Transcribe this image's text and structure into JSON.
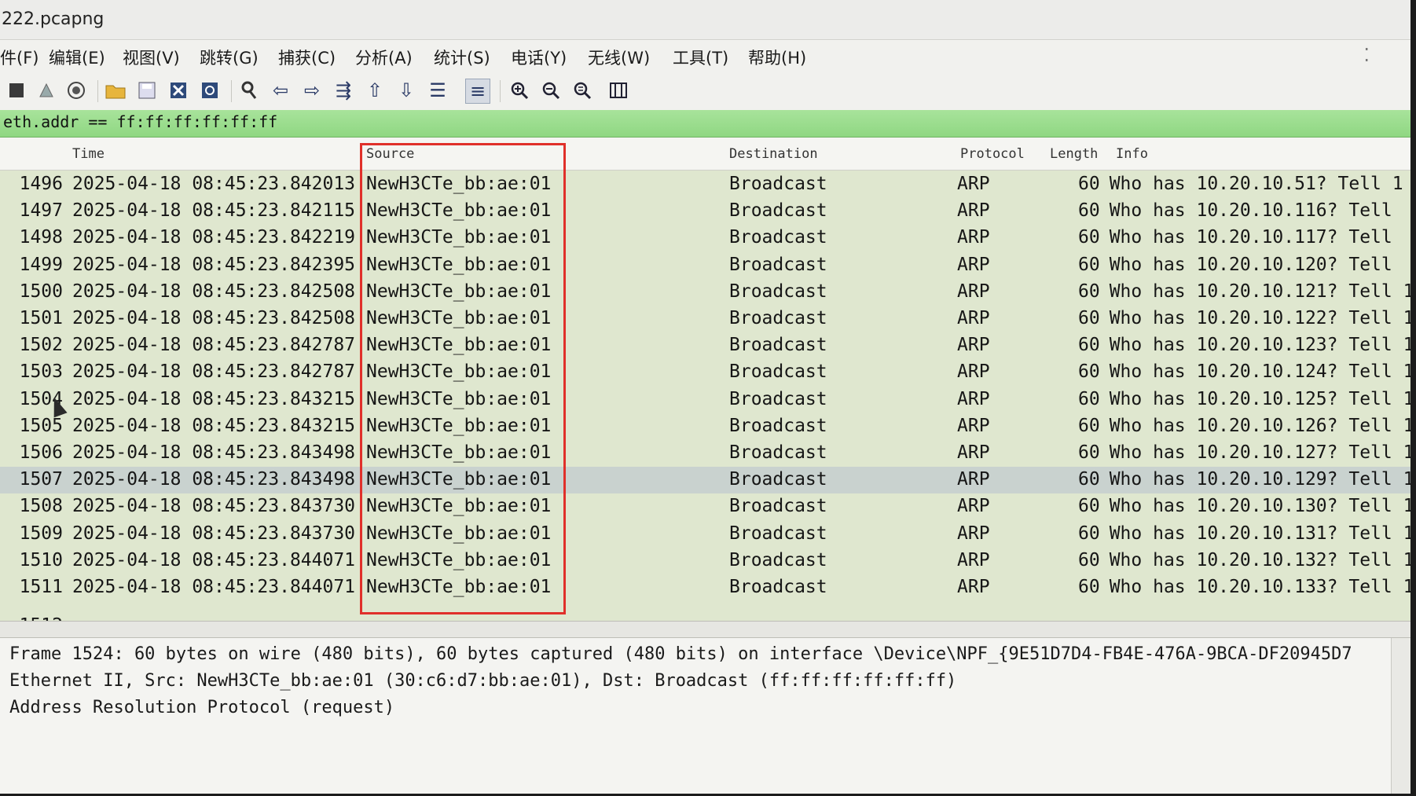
{
  "window": {
    "title": "222.pcapng"
  },
  "menu": [
    "件(F)",
    "编辑(E)",
    "视图(V)",
    "跳转(G)",
    "捕获(C)",
    "分析(A)",
    "统计(S)",
    "电话(Y)",
    "无线(W)",
    "工具(T)",
    "帮助(H)"
  ],
  "toolbar": {
    "icons": [
      "stop-capture-icon",
      "restart-capture-icon",
      "capture-options-icon",
      "open-file-icon",
      "save-file-icon",
      "close-file-icon",
      "reload-file-icon",
      "find-packet-icon",
      "go-back-icon",
      "go-forward-icon",
      "go-to-packet-icon",
      "go-first-icon",
      "go-last-icon",
      "autoscroll-icon",
      "colorize-icon",
      "zoom-in-icon",
      "zoom-out-icon",
      "zoom-normal-icon",
      "resize-columns-icon"
    ]
  },
  "filter": {
    "value": "eth.addr == ff:ff:ff:ff:ff:ff"
  },
  "columns": {
    "time": "Time",
    "source": "Source",
    "destination": "Destination",
    "protocol": "Protocol",
    "length": "Length",
    "info": "Info"
  },
  "packets": [
    {
      "no": "1496",
      "time": "2025-04-18 08:45:23.842013",
      "source": "NewH3CTe_bb:ae:01",
      "destination": "Broadcast",
      "protocol": "ARP",
      "length": "60",
      "info": "Who has 10.20.10.51? Tell 1"
    },
    {
      "no": "1497",
      "time": "2025-04-18 08:45:23.842115",
      "source": "NewH3CTe_bb:ae:01",
      "destination": "Broadcast",
      "protocol": "ARP",
      "length": "60",
      "info": "Who has 10.20.10.116? Tell"
    },
    {
      "no": "1498",
      "time": "2025-04-18 08:45:23.842219",
      "source": "NewH3CTe_bb:ae:01",
      "destination": "Broadcast",
      "protocol": "ARP",
      "length": "60",
      "info": "Who has 10.20.10.117? Tell"
    },
    {
      "no": "1499",
      "time": "2025-04-18 08:45:23.842395",
      "source": "NewH3CTe_bb:ae:01",
      "destination": "Broadcast",
      "protocol": "ARP",
      "length": "60",
      "info": "Who has 10.20.10.120? Tell"
    },
    {
      "no": "1500",
      "time": "2025-04-18 08:45:23.842508",
      "source": "NewH3CTe_bb:ae:01",
      "destination": "Broadcast",
      "protocol": "ARP",
      "length": "60",
      "info": "Who has 10.20.10.121? Tell 1"
    },
    {
      "no": "1501",
      "time": "2025-04-18 08:45:23.842508",
      "source": "NewH3CTe_bb:ae:01",
      "destination": "Broadcast",
      "protocol": "ARP",
      "length": "60",
      "info": "Who has 10.20.10.122? Tell 1"
    },
    {
      "no": "1502",
      "time": "2025-04-18 08:45:23.842787",
      "source": "NewH3CTe_bb:ae:01",
      "destination": "Broadcast",
      "protocol": "ARP",
      "length": "60",
      "info": "Who has 10.20.10.123? Tell 1"
    },
    {
      "no": "1503",
      "time": "2025-04-18 08:45:23.842787",
      "source": "NewH3CTe_bb:ae:01",
      "destination": "Broadcast",
      "protocol": "ARP",
      "length": "60",
      "info": "Who has 10.20.10.124? Tell 1"
    },
    {
      "no": "1504",
      "time": "2025-04-18 08:45:23.843215",
      "source": "NewH3CTe_bb:ae:01",
      "destination": "Broadcast",
      "protocol": "ARP",
      "length": "60",
      "info": "Who has 10.20.10.125? Tell 1"
    },
    {
      "no": "1505",
      "time": "2025-04-18 08:45:23.843215",
      "source": "NewH3CTe_bb:ae:01",
      "destination": "Broadcast",
      "protocol": "ARP",
      "length": "60",
      "info": "Who has 10.20.10.126? Tell 1"
    },
    {
      "no": "1506",
      "time": "2025-04-18 08:45:23.843498",
      "source": "NewH3CTe_bb:ae:01",
      "destination": "Broadcast",
      "protocol": "ARP",
      "length": "60",
      "info": "Who has 10.20.10.127? Tell 1"
    },
    {
      "no": "1507",
      "time": "2025-04-18 08:45:23.843498",
      "source": "NewH3CTe_bb:ae:01",
      "destination": "Broadcast",
      "protocol": "ARP",
      "length": "60",
      "info": "Who has 10.20.10.129? Tell 1",
      "selected": true
    },
    {
      "no": "1508",
      "time": "2025-04-18 08:45:23.843730",
      "source": "NewH3CTe_bb:ae:01",
      "destination": "Broadcast",
      "protocol": "ARP",
      "length": "60",
      "info": "Who has 10.20.10.130? Tell 1"
    },
    {
      "no": "1509",
      "time": "2025-04-18 08:45:23.843730",
      "source": "NewH3CTe_bb:ae:01",
      "destination": "Broadcast",
      "protocol": "ARP",
      "length": "60",
      "info": "Who has 10.20.10.131? Tell 1"
    },
    {
      "no": "1510",
      "time": "2025-04-18 08:45:23.844071",
      "source": "NewH3CTe_bb:ae:01",
      "destination": "Broadcast",
      "protocol": "ARP",
      "length": "60",
      "info": "Who has 10.20.10.132? Tell 1"
    },
    {
      "no": "1511",
      "time": "2025-04-18 08:45:23.844071",
      "source": "NewH3CTe_bb:ae:01",
      "destination": "Broadcast",
      "protocol": "ARP",
      "length": "60",
      "info": "Who has 10.20.10.133? Tell 1"
    }
  ],
  "details": {
    "frame": "Frame 1524: 60 bytes on wire (480 bits), 60 bytes captured (480 bits) on interface \\Device\\NPF_{9E51D7D4-FB4E-476A-9BCA-DF20945D7",
    "ethernet": "Ethernet II, Src: NewH3CTe_bb:ae:01 (30:c6:d7:bb:ae:01), Dst: Broadcast (ff:ff:ff:ff:ff:ff)",
    "arp": "Address Resolution Protocol (request)"
  },
  "colors": {
    "filter_valid": "#a8e39b",
    "highlight_box": "#e0302a",
    "row_bg": "#dfe7cf",
    "selected_row": "#c9d2cf"
  }
}
